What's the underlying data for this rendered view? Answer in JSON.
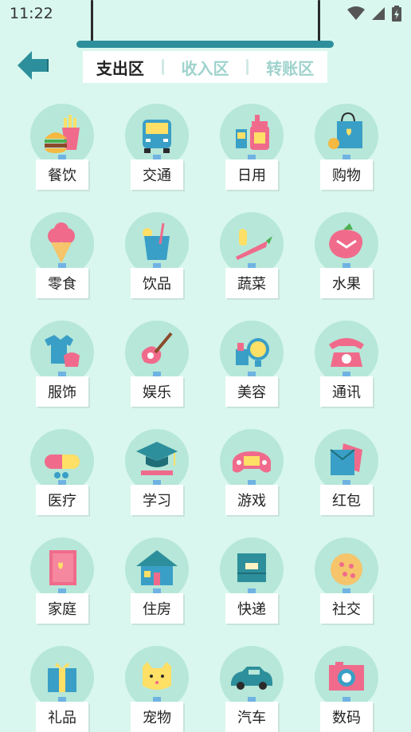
{
  "status_bar": {
    "time": "11:22"
  },
  "tabs": [
    {
      "label": "支出区",
      "active": true
    },
    {
      "label": "收入区",
      "active": false
    },
    {
      "label": "转账区",
      "active": false
    }
  ],
  "categories": [
    {
      "label": "餐饮",
      "icon": "burger-fries-icon"
    },
    {
      "label": "交通",
      "icon": "bus-icon"
    },
    {
      "label": "日用",
      "icon": "toiletries-icon"
    },
    {
      "label": "购物",
      "icon": "shopping-bag-icon"
    },
    {
      "label": "零食",
      "icon": "ice-cream-icon"
    },
    {
      "label": "饮品",
      "icon": "drink-cup-icon"
    },
    {
      "label": "蔬菜",
      "icon": "vegetables-icon"
    },
    {
      "label": "水果",
      "icon": "strawberry-icon"
    },
    {
      "label": "服饰",
      "icon": "clothes-icon"
    },
    {
      "label": "娱乐",
      "icon": "guitar-icon"
    },
    {
      "label": "美容",
      "icon": "mirror-icon"
    },
    {
      "label": "通讯",
      "icon": "telephone-icon"
    },
    {
      "label": "医疗",
      "icon": "pill-icon"
    },
    {
      "label": "学习",
      "icon": "graduation-cap-icon"
    },
    {
      "label": "游戏",
      "icon": "gamepad-icon"
    },
    {
      "label": "红包",
      "icon": "red-envelope-icon"
    },
    {
      "label": "家庭",
      "icon": "photo-frame-icon"
    },
    {
      "label": "住房",
      "icon": "house-icon"
    },
    {
      "label": "快递",
      "icon": "package-icon"
    },
    {
      "label": "社交",
      "icon": "pizza-icon"
    },
    {
      "label": "礼品",
      "icon": "gift-icon"
    },
    {
      "label": "宠物",
      "icon": "pet-cat-icon"
    },
    {
      "label": "汽车",
      "icon": "car-icon"
    },
    {
      "label": "数码",
      "icon": "camera-icon"
    }
  ],
  "colors": {
    "background": "#d9f7ee",
    "accent_teal": "#2d8f9b",
    "circle": "#b6e7d9",
    "pink": "#f06b8b",
    "yellow": "#ffe066",
    "blue": "#3a9fc6"
  }
}
